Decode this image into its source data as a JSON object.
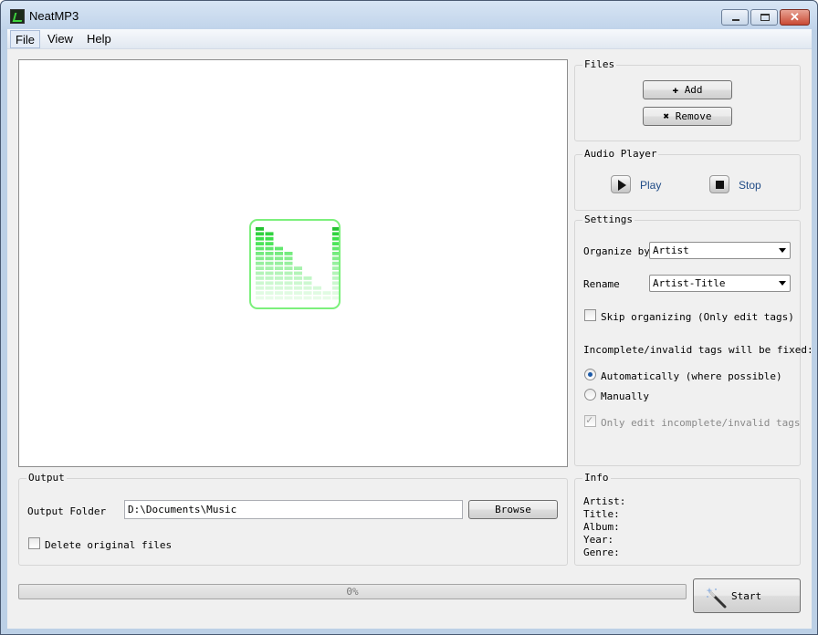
{
  "window": {
    "title": "NeatMP3",
    "close_label": "✕"
  },
  "menu": {
    "file": "File",
    "view": "View",
    "help": "Help"
  },
  "files": {
    "title": "Files",
    "add_label": "Add",
    "remove_label": "Remove"
  },
  "player": {
    "title": "Audio Player",
    "play_label": "Play",
    "stop_label": "Stop"
  },
  "settings": {
    "title": "Settings",
    "organize_label": "Organize by",
    "organize_value": "Artist",
    "rename_label": "Rename",
    "rename_value": "Artist-Title",
    "skip_label": "Skip organizing (Only edit tags)",
    "skip_checked": false,
    "fix_label": "Incomplete/invalid tags will be fixed:",
    "auto_label": "Automatically (where possible)",
    "manual_label": "Manually",
    "fix_mode": "auto",
    "only_invalid_label": "Only edit incomplete/invalid tags",
    "only_invalid_checked": true,
    "only_invalid_disabled": true
  },
  "output": {
    "title": "Output",
    "folder_label": "Output Folder",
    "folder_value": "D:\\Documents\\Music",
    "browse_label": "Browse",
    "delete_label": "Delete original files",
    "delete_checked": false
  },
  "info": {
    "title": "Info",
    "artist_label": "Artist:",
    "title_label": "Title:",
    "album_label": "Album:",
    "year_label": "Year:",
    "genre_label": "Genre:"
  },
  "progress": {
    "text": "0%",
    "value": 0
  },
  "start_label": "Start",
  "colors": {
    "accent": "#1c5aa8",
    "logo_green": "#7cf07c",
    "player_link": "#1f4b86"
  },
  "icons": {
    "app": "app-logo-icon",
    "add": "plus-icon",
    "remove": "x-icon",
    "play": "play-icon",
    "stop": "stop-icon",
    "start": "magic-wand-icon",
    "logo": "equalizer-logo-icon"
  }
}
